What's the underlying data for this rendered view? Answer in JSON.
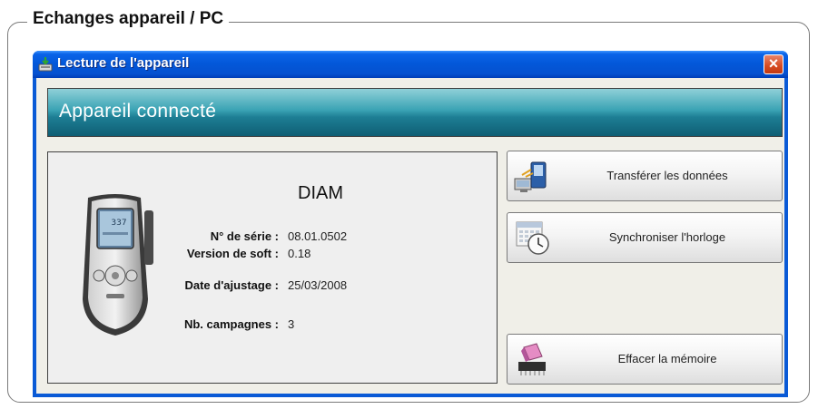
{
  "group": {
    "title": "Echanges appareil / PC"
  },
  "window": {
    "title": "Lecture de l'appareil",
    "close_symbol": "×"
  },
  "banner": {
    "text": "Appareil connecté"
  },
  "device": {
    "model": "DIAM",
    "screen_value": "337",
    "fields": [
      {
        "label": "N° de série :",
        "value": "08.01.0502"
      },
      {
        "label": "Version de soft :",
        "value": "0.18"
      },
      {
        "label": "Date d'ajustage :",
        "value": "25/03/2008"
      },
      {
        "label": "Nb. campagnes :",
        "value": "3"
      }
    ]
  },
  "actions": [
    {
      "label": "Transférer les données",
      "icon": "pda-transfer-icon"
    },
    {
      "label": "Synchroniser l'horloge",
      "icon": "calendar-clock-icon"
    },
    {
      "label": "Effacer la mémoire",
      "icon": "eraser-chip-icon"
    }
  ],
  "colors": {
    "titlebar": "#0357d8",
    "banner": "#1d7e94",
    "close": "#d64a20"
  }
}
